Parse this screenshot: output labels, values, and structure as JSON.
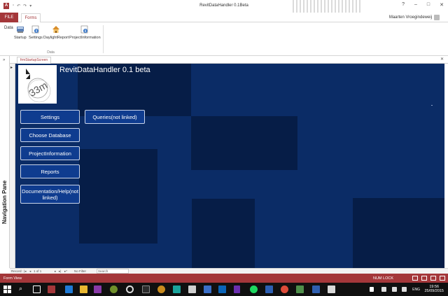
{
  "window": {
    "title": "RevitDataHandler 0.1Beta",
    "controls": [
      "?",
      "–",
      "□",
      "✕"
    ]
  },
  "ribbon_tabs": {
    "file": "FILE",
    "forms": "Forms"
  },
  "user": {
    "name": "Maarten Vroegindeweij"
  },
  "ribbon": {
    "left_label": "Data",
    "buttons": [
      "Startup",
      "Settings",
      "DaylightReport",
      "ProjectInformation"
    ],
    "group_label": "Data"
  },
  "nav_pane": {
    "label": "Navigation Pane"
  },
  "document_tab": {
    "label": "frmStartupScreen"
  },
  "form": {
    "title": "RevitDataHandler 0.1 beta",
    "logo_text": "33m",
    "buttons": {
      "settings": "Settings",
      "queries": "Queries(not linked)",
      "choose_database": "Choose Database",
      "project_information": "ProjectInformation",
      "reports": "Reports",
      "documentation": "Documentation/Help(not linked)"
    }
  },
  "record_nav": {
    "record_label": "Record:",
    "position": "1 of 1",
    "filter": "No Filter",
    "search": "Search"
  },
  "status": {
    "view": "Form View",
    "num_lock": "NUM LOCK"
  },
  "taskbar": {
    "language": "ENG",
    "time": "19:56",
    "date": "25/09/2015"
  }
}
